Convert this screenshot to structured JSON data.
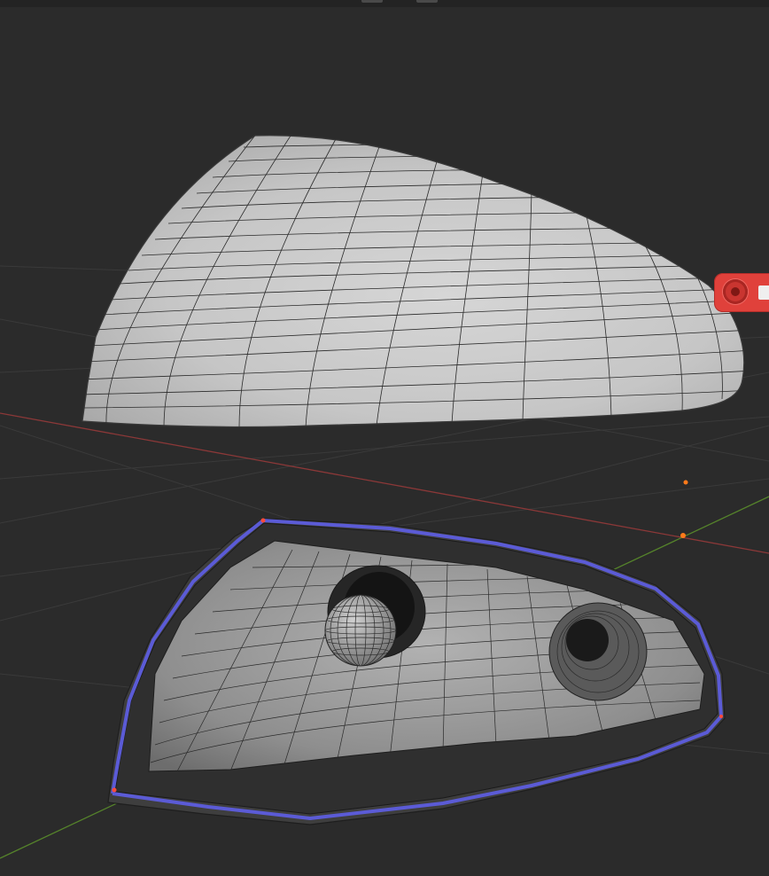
{
  "app": {
    "name": "3D viewport",
    "mode": "edit-mode"
  },
  "scene": {
    "objects": [
      {
        "id": "mirror-shell-outer",
        "shading": "solid-wireframe",
        "color": "#c9c9c9"
      },
      {
        "id": "mirror-housing-inner",
        "shading": "solid-wireframe",
        "color": "#9a9a9a"
      }
    ],
    "axes": {
      "x_color": "#9a3b3b",
      "y_color": "#5a8a2e"
    },
    "selection_edge_color": "#5b5bd6",
    "origin_dot_color": "#ff7a1a"
  },
  "icons": {
    "navigation_gizmo": "camera-rotate-icon"
  }
}
